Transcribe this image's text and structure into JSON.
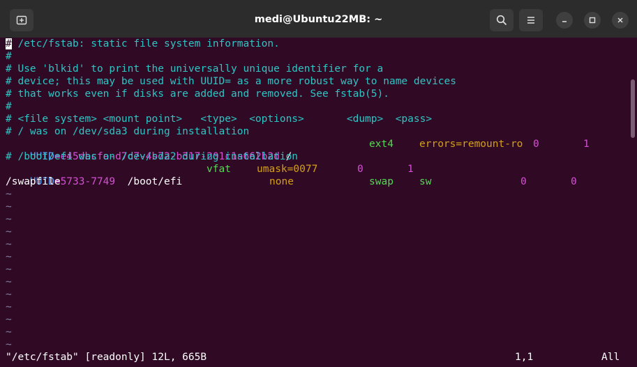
{
  "window": {
    "title": "medi@Ubuntu22MB: ~"
  },
  "icons": {
    "new_tab": "new-tab-icon",
    "search": "search-icon",
    "menu": "hamburger-menu-icon",
    "minimize": "minimize-icon",
    "maximize": "maximize-icon",
    "close": "close-icon"
  },
  "lines": {
    "l1": "/etc/fstab: static file system information.",
    "l2": "#",
    "l3": "# Use 'blkid' to print the universally unique identifier for a",
    "l4": "# device; this may be used with UUID= as a more robust way to name devices",
    "l5": "# that works even if disks are added and removed. See fstab(5).",
    "l6": "#",
    "l7": "# <file system> <mount point>   <type>  <options>       <dump>  <pass>",
    "l8": "# / was on /dev/sda3 during installation",
    "l9_key": "UUID",
    "l9_val": "=e45dbcfa-d7c7-4b72-b317-201c1a662b2d",
    "l9_mount": " /               ",
    "l9_type": "ext4",
    "l9_opt": "errors=remount-ro",
    "l9_dump": "0",
    "l9_pass": "1",
    "l10": "# /boot/efi was on /dev/sda2 during installation",
    "l11_key": "UUID",
    "l11_val": "=5733-7749",
    "l11_mount": "  /boot/efi       ",
    "l11_type": "vfat",
    "l11_opt": "umask=0077",
    "l11_dump": "0",
    "l11_pass": "1",
    "l12_fs": "/swapfile",
    "l12_mount": "none",
    "l12_type": "swap",
    "l12_opt": "sw",
    "l12_dump": "0",
    "l12_pass": "0"
  },
  "cursor_char": "#",
  "tilde": "~",
  "status": {
    "file": "\"/etc/fstab\" [readonly] 12L, 665B",
    "position": "1,1",
    "scroll": "All"
  },
  "colors": {
    "background": "#300a24",
    "comment": "#2ec5c5",
    "uuid_key": "#5fa6ff",
    "uuid_value": "#d350d3",
    "fs_type": "#4fdc4f",
    "options": "#d4a017",
    "titlebar": "#2c2c2c"
  }
}
